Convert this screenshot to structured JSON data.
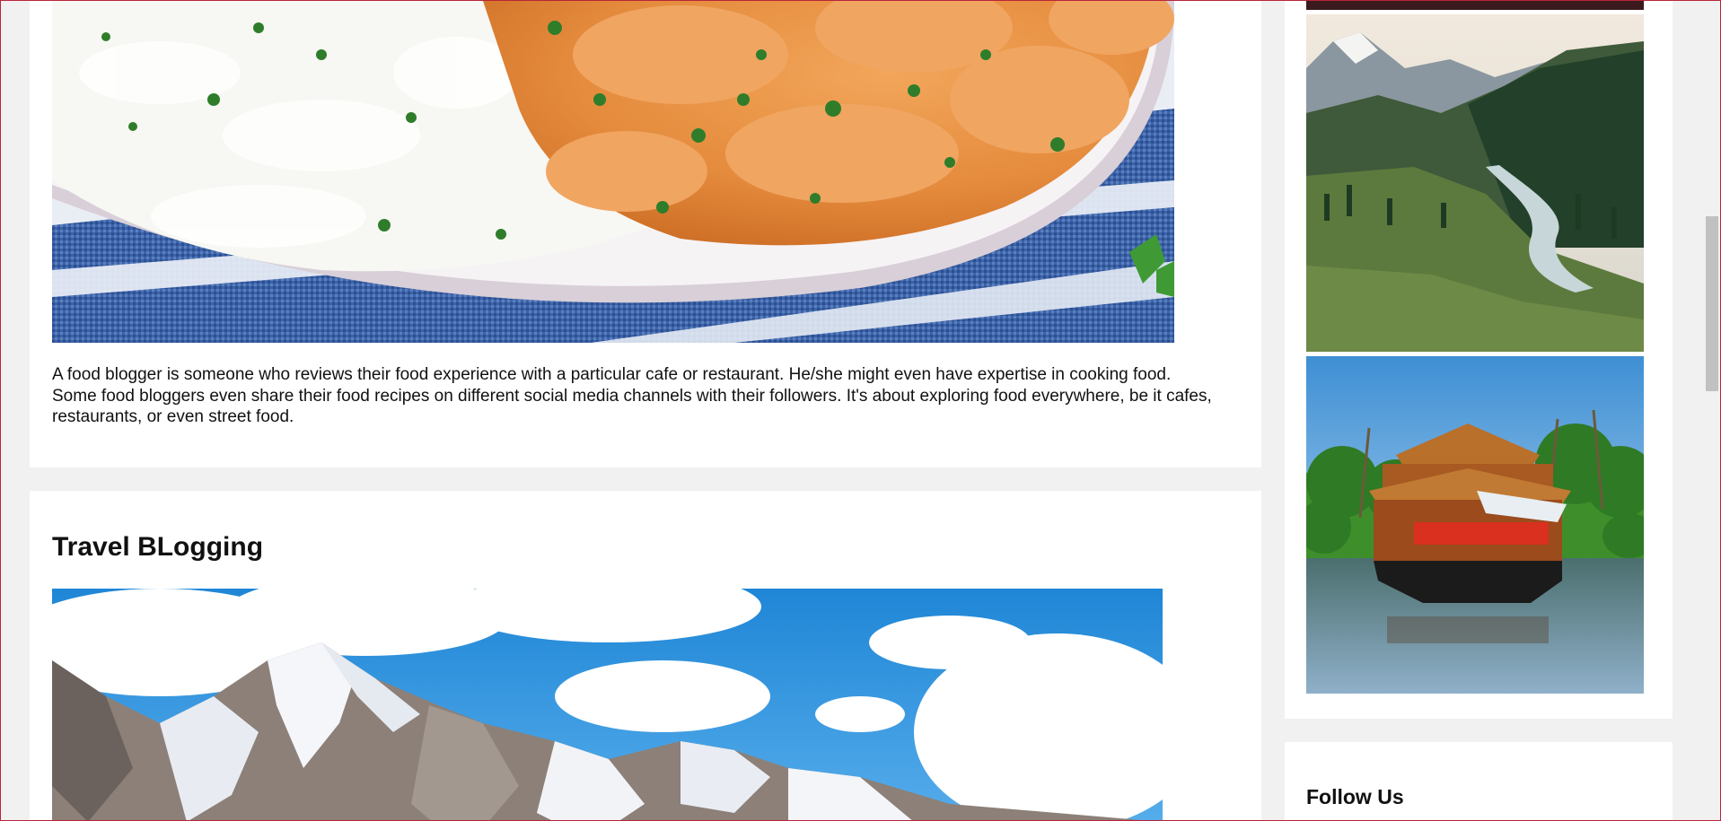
{
  "food_section": {
    "image_alt": "Plate of butter chicken with basmati rice on a blue striped cloth",
    "description": "A food blogger is someone who reviews their food experience with a particular cafe or restaurant. He/she might even have expertise in cooking food. Some food bloggers even share their food recipes on different social media channels with their followers. It's about exploring food everywhere, be it cafes, restaurants, or even street food."
  },
  "travel_section": {
    "title": "Travel BLogging",
    "image_alt": "Snow-capped mountains under a blue cloudy sky"
  },
  "sidebar": {
    "gallery": [
      {
        "alt": "Green mountain valley with a river"
      },
      {
        "alt": "Houseboat on backwaters with palm trees"
      }
    ],
    "follow_title": "Follow Us"
  },
  "colors": {
    "page_bg": "#f1f1f1",
    "card_bg": "#ffffff",
    "frame_border": "#b8243a"
  }
}
